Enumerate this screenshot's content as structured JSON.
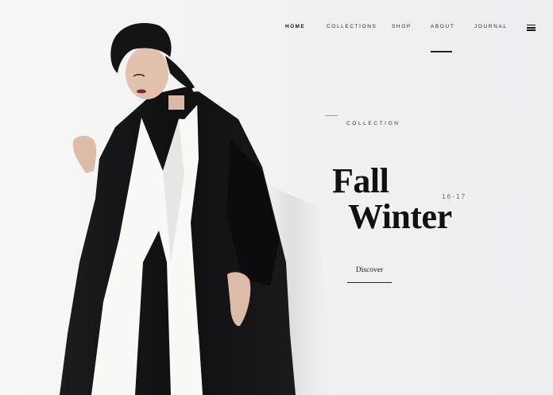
{
  "nav": {
    "items": [
      {
        "label": "HOME",
        "active": true
      },
      {
        "label": "COLLECTIONS",
        "active": false
      },
      {
        "label": "SHOP",
        "active": false
      },
      {
        "label": "ABOUT",
        "active": false
      },
      {
        "label": "JOURNAL",
        "active": false
      }
    ],
    "menu_icon": "hamburger-menu-icon",
    "hovered_item": "ABOUT"
  },
  "hero": {
    "eyebrow": "COLLECTION",
    "title_line1": "Fall",
    "title_line2": "Winter",
    "season": "16-17",
    "cta_label": "Discover"
  },
  "colors": {
    "background": "#f2f2f4",
    "text": "#111111",
    "coat": "#141414",
    "scarf": "#f8f8f6",
    "trousers": "#5a1c26"
  }
}
